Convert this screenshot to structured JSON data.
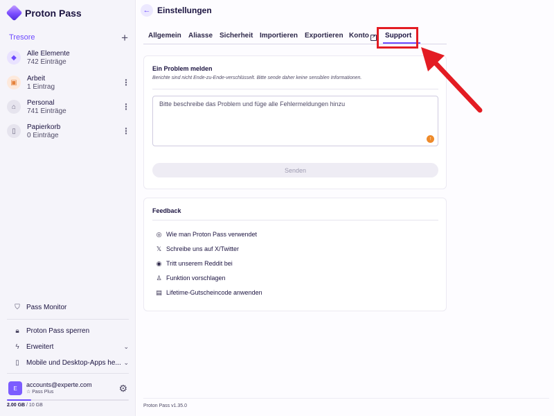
{
  "brand": {
    "name": "Proton Pass"
  },
  "sidebar": {
    "vaults_title": "Tresore",
    "add_icon": "plus-icon",
    "vaults": [
      {
        "name": "Alle Elemente",
        "count": "742 Einträge",
        "icon": "diamond-icon",
        "color": "#6d4aff",
        "bg": "#e9e2ff"
      },
      {
        "name": "Arbeit",
        "count": "1 Eintrag",
        "icon": "briefcase-icon",
        "color": "#e5833d",
        "bg": "#fde9dc"
      },
      {
        "name": "Personal",
        "count": "741 Einträge",
        "icon": "home-icon",
        "color": "#6b6680",
        "bg": "#e6e4ee"
      },
      {
        "name": "Papierkorb",
        "count": "0 Einträge",
        "icon": "trash-icon",
        "color": "#6b6680",
        "bg": "#e6e4ee"
      }
    ],
    "links": {
      "monitor": "Pass Monitor",
      "lock": "Proton Pass sperren",
      "advanced": "Erweitert",
      "apps": "Mobile und Desktop-Apps he..."
    },
    "account": {
      "initial": "E",
      "email": "accounts@experte.com",
      "plan": "Pass Plus"
    },
    "storage": {
      "used": "2.00 GB",
      "total": "/ 10 GB",
      "fraction": 0.2
    }
  },
  "main": {
    "title": "Einstellungen",
    "tabs": [
      "Allgemein",
      "Aliasse",
      "Sicherheit",
      "Importieren",
      "Exportieren",
      "Konto",
      "Support"
    ],
    "active_tab": "Support",
    "report": {
      "title": "Ein Problem melden",
      "subtitle": "Berichte sind nicht Ende-zu-Ende-verschlüsselt. Bitte sende daher keine sensiblen Informationen.",
      "placeholder": "Bitte beschreibe das Problem und füge alle Fehlermeldungen hinzu",
      "send_label": "Senden"
    },
    "feedback": {
      "title": "Feedback",
      "items": [
        {
          "label": "Wie man Proton Pass verwendet",
          "icon": "life-ring-icon"
        },
        {
          "label": "Schreibe uns auf X/Twitter",
          "icon": "x-twitter-icon"
        },
        {
          "label": "Tritt unserem Reddit bei",
          "icon": "reddit-icon"
        },
        {
          "label": "Funktion vorschlagen",
          "icon": "lightbulb-icon"
        },
        {
          "label": "Lifetime-Gutscheincode anwenden",
          "icon": "gift-icon"
        }
      ]
    },
    "version": "Proton Pass v1.35.0"
  },
  "annotation": {
    "color": "#e31c23"
  }
}
